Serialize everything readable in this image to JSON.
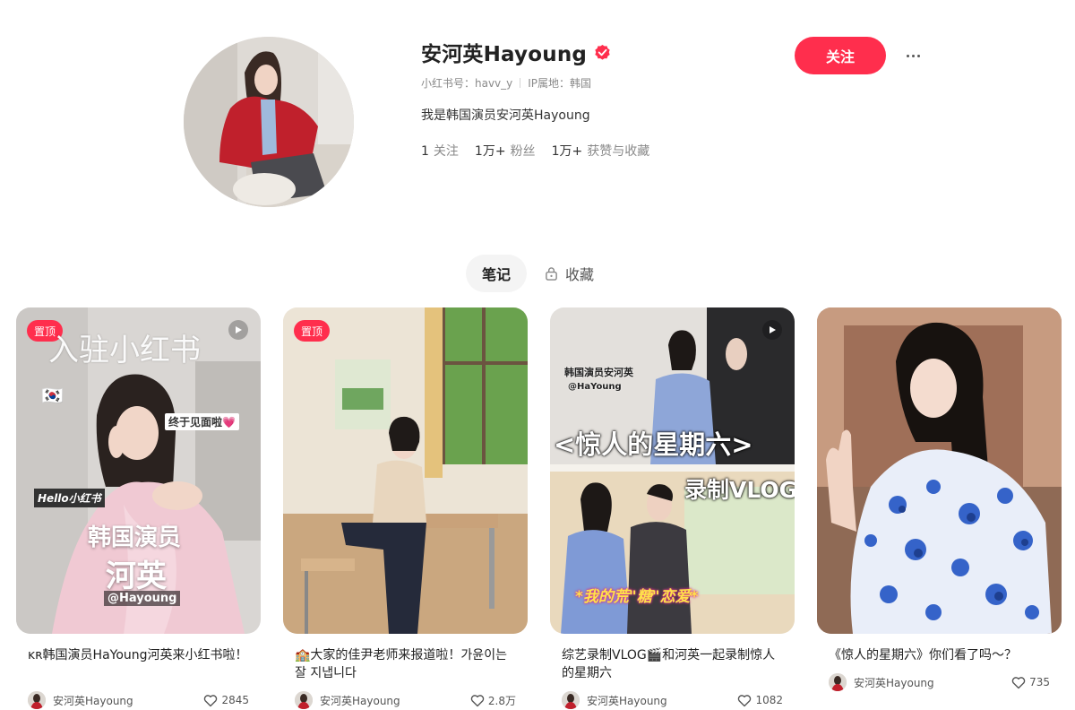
{
  "profile": {
    "name": "安河英Hayoung",
    "xhs_id_label": "小红书号：havv_y",
    "ip_label": "IP属地：韩国",
    "bio": "我是韩国演员安河英Hayoung",
    "stats": [
      {
        "num": "1",
        "label": "关注"
      },
      {
        "num": "1万+",
        "label": "粉丝"
      },
      {
        "num": "1万+",
        "label": "获赞与收藏"
      }
    ],
    "verified_color": "#ff2e4d"
  },
  "actions": {
    "follow_label": "关注",
    "more_icon": "more-dots-icon"
  },
  "tabs": [
    {
      "label": "笔记",
      "active": true
    },
    {
      "label": "收藏",
      "active": false,
      "icon": "lock-icon"
    }
  ],
  "colors": {
    "accent": "#ff2e4d",
    "text": "#222222",
    "muted": "#8a8a8a"
  },
  "notes": [
    {
      "pinned": true,
      "pin_label": "置顶",
      "video": true,
      "overlay": [
        "入驻小红书",
        "终于见面啦💗",
        "Hello小红书",
        "韩国演员",
        "河英",
        "@Hayoung"
      ],
      "title": "ᴋʀ韩国演员HaYoung河英来小红书啦！",
      "author": "安河英Hayoung",
      "likes": "2845"
    },
    {
      "pinned": true,
      "pin_label": "置顶",
      "video": false,
      "overlay": [],
      "title": "🏫大家的佳尹老师来报道啦！가윤이는 잘 지냅니다",
      "author": "安河英Hayoung",
      "likes": "2.8万"
    },
    {
      "pinned": false,
      "video": true,
      "overlay": [
        "韩国演员安河英",
        "@HaYoung",
        "<惊人的星期六>",
        "录制VLOG",
        "*我的荒\"糖\"恋爱*"
      ],
      "title": "综艺录制VLOG🎬和河英一起录制惊人的星期六",
      "author": "安河英Hayoung",
      "likes": "1082"
    },
    {
      "pinned": false,
      "video": false,
      "overlay": [],
      "title": "《惊人的星期六》你们看了吗～？",
      "author": "安河英Hayoung",
      "likes": "735"
    }
  ]
}
